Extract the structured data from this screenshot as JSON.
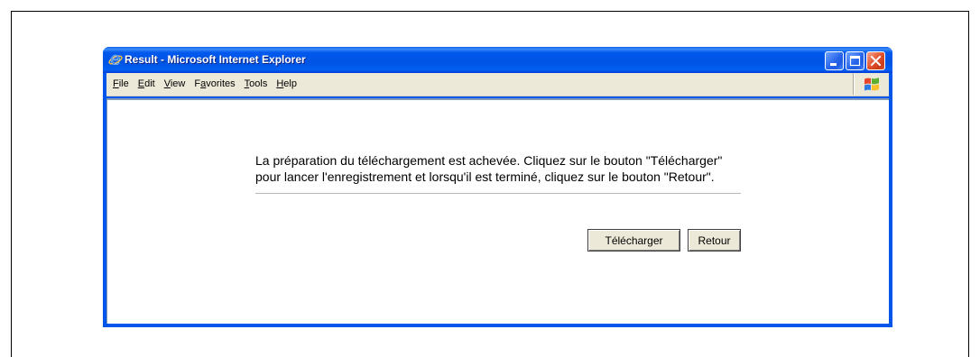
{
  "window": {
    "title": "Result - Microsoft Internet Explorer",
    "icon": "internet-explorer-icon",
    "controls": {
      "minimize_icon": "minimize-icon",
      "maximize_icon": "maximize-icon",
      "close_icon": "close-icon"
    }
  },
  "menu": {
    "items": [
      {
        "label": "File",
        "accel": 0
      },
      {
        "label": "Edit",
        "accel": 0
      },
      {
        "label": "View",
        "accel": 0
      },
      {
        "label": "Favorites",
        "accel": 1
      },
      {
        "label": "Tools",
        "accel": 0
      },
      {
        "label": "Help",
        "accel": 0
      }
    ],
    "logo_icon": "windows-logo-icon"
  },
  "content": {
    "message": "La préparation du téléchargement est achevée. Cliquez sur le bouton \"Télécharger\" pour lancer l'enregistrement et lorsqu'il est terminé, cliquez sur le bouton \"Retour\".",
    "buttons": {
      "download": "Télécharger",
      "back": "Retour"
    }
  },
  "colors": {
    "title_bar": "#0054E3",
    "window_frame": "#0055EA",
    "menu_bar": "#ECE9D8",
    "close_button": "#E2512C",
    "content_background": "#FFFFFF",
    "button_face": "#ECE9D8"
  }
}
